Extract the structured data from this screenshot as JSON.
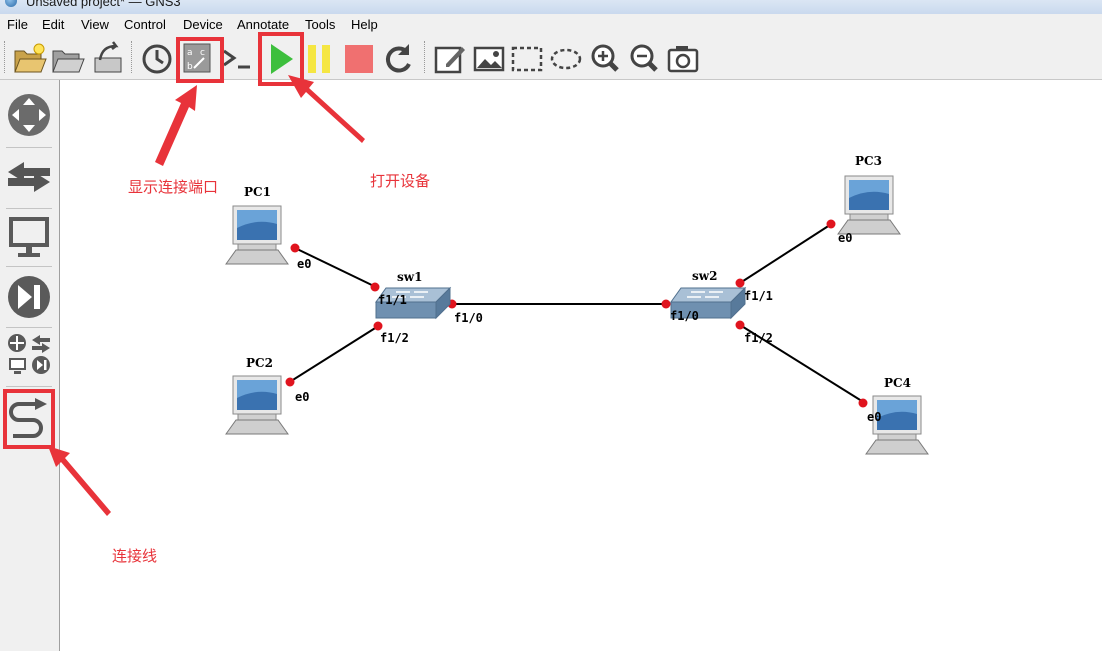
{
  "window": {
    "title": "Unsaved project* — GNS3"
  },
  "menu": [
    "File",
    "Edit",
    "View",
    "Control",
    "Device",
    "Annotate",
    "Tools",
    "Help"
  ],
  "annotations": {
    "show_ports": "显示连接端口",
    "start_devices": "打开设备",
    "add_link": "连接线"
  },
  "topology": {
    "nodes": [
      {
        "id": "pc1",
        "label": "PC1",
        "type": "pc"
      },
      {
        "id": "pc2",
        "label": "PC2",
        "type": "pc"
      },
      {
        "id": "pc3",
        "label": "PC3",
        "type": "pc"
      },
      {
        "id": "pc4",
        "label": "PC4",
        "type": "pc"
      },
      {
        "id": "sw1",
        "label": "sw1",
        "type": "switch"
      },
      {
        "id": "sw2",
        "label": "sw2",
        "type": "switch"
      }
    ],
    "links": [
      {
        "a": "pc1",
        "a_port": "e0",
        "b": "sw1",
        "b_port": "f1/1"
      },
      {
        "a": "pc2",
        "a_port": "e0",
        "b": "sw1",
        "b_port": "f1/2"
      },
      {
        "a": "sw1",
        "a_port": "f1/0",
        "b": "sw2",
        "b_port": "f1/0"
      },
      {
        "a": "pc3",
        "a_port": "e0",
        "b": "sw2",
        "b_port": "f1/1"
      },
      {
        "a": "pc4",
        "a_port": "e0",
        "b": "sw2",
        "b_port": "f1/2"
      }
    ]
  },
  "colors": {
    "annotation": "#e8333a",
    "port_dot": "#e0141e",
    "play_green": "#3dbf3d",
    "pause_yellow": "#f5e642",
    "stop_red": "#f07070"
  }
}
